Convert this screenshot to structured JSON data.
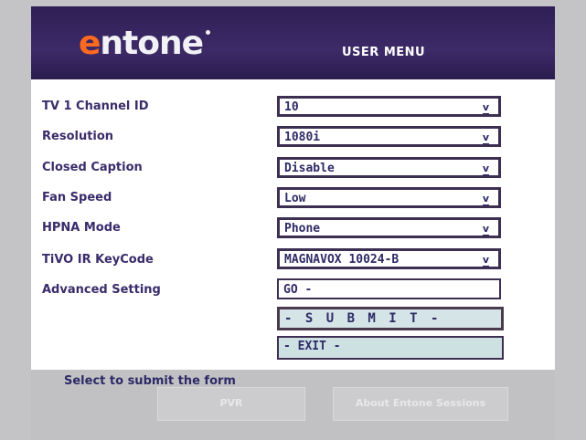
{
  "header": {
    "logo_first": "e",
    "logo_rest": "ntone",
    "title": "USER MENU"
  },
  "form": {
    "rows": [
      {
        "label": "TV 1 Channel ID",
        "value": "10",
        "arrow": "v"
      },
      {
        "label": "Resolution",
        "value": "1080i",
        "arrow": "v"
      },
      {
        "label": "Closed Caption",
        "value": "Disable",
        "arrow": "v"
      },
      {
        "label": "Fan Speed",
        "value": "Low",
        "arrow": "v"
      },
      {
        "label": "HPNA Mode",
        "value": "Phone",
        "arrow": "v"
      },
      {
        "label": "TiVO IR KeyCode",
        "value": "MAGNAVOX 10024-B",
        "arrow": "v"
      },
      {
        "label": "Advanced Setting",
        "value": "GO -"
      }
    ],
    "submit_label": "- S U B M I T -",
    "exit_label": "- EXIT -"
  },
  "footer": {
    "status": "Select to submit the form",
    "ghost_buttons": [
      "PVR",
      "About Entone Sessions"
    ]
  },
  "colors": {
    "header_bg": "#3d2a68",
    "logo_accent": "#ff6a1f",
    "text": "#2e2a66",
    "button_bg": "#cde1e3"
  }
}
